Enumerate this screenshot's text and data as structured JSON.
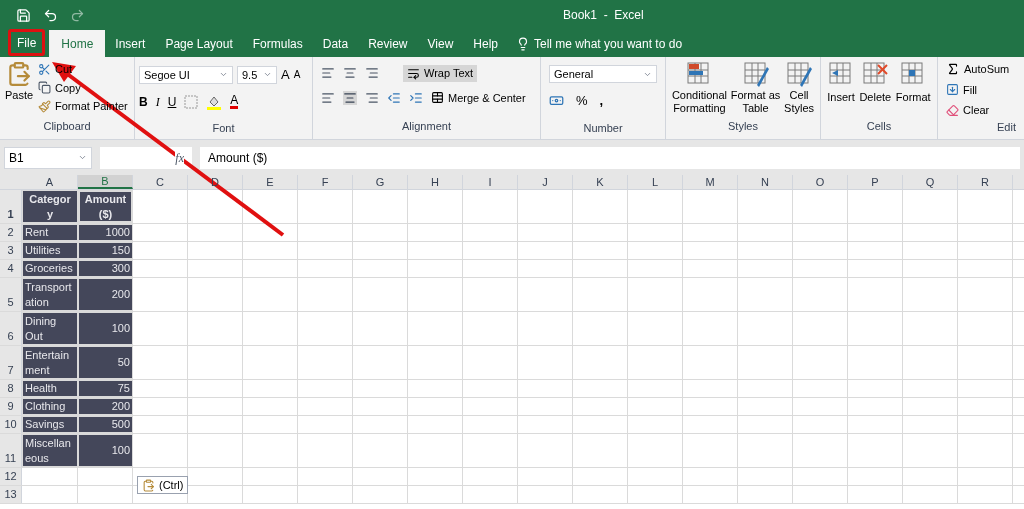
{
  "title_bar": {
    "title": "Book1  -  Excel"
  },
  "tabs": [
    {
      "label": "File",
      "selected": false
    },
    {
      "label": "Home",
      "selected": true
    },
    {
      "label": "Insert",
      "selected": false
    },
    {
      "label": "Page Layout",
      "selected": false
    },
    {
      "label": "Formulas",
      "selected": false
    },
    {
      "label": "Data",
      "selected": false
    },
    {
      "label": "Review",
      "selected": false
    },
    {
      "label": "View",
      "selected": false
    },
    {
      "label": "Help",
      "selected": false
    }
  ],
  "tell_me": {
    "placeholder": "Tell me what you want to do"
  },
  "ribbon": {
    "clipboard": {
      "label": "Clipboard",
      "paste": "Paste",
      "cut": "Cut",
      "copy": "Copy",
      "format_painter": "Format Painter"
    },
    "font": {
      "label": "Font",
      "font_name": "Segoe UI",
      "font_size": "9.5",
      "bold": "B",
      "italic": "I",
      "underline": "U",
      "grow": "A",
      "shrink": "A",
      "font_color": "A"
    },
    "alignment": {
      "label": "Alignment",
      "wrap_text": "Wrap Text",
      "merge": "Merge & Center"
    },
    "number": {
      "label": "Number",
      "format": "General",
      "percent": "%",
      "comma": ","
    },
    "styles": {
      "label": "Styles",
      "buttons": [
        [
          "Conditional",
          "Formatting"
        ],
        [
          "Format as",
          "Table"
        ],
        [
          "Cell",
          "Styles"
        ]
      ]
    },
    "cells": {
      "label": "Cells",
      "buttons": [
        "Insert",
        "Delete",
        "Format"
      ]
    },
    "editing": {
      "label": "Edit",
      "autosum": "AutoSum",
      "fill": "Fill",
      "clear": "Clear"
    }
  },
  "formula_bar": {
    "name_box": "B1",
    "function_label": "fx",
    "value": "Amount ($)"
  },
  "sheet": {
    "columns": [
      {
        "label": "A",
        "selected": false
      },
      {
        "label": "B",
        "selected": true
      },
      {
        "label": "C",
        "selected": false
      },
      {
        "label": "D",
        "selected": false
      },
      {
        "label": "E",
        "selected": false
      },
      {
        "label": "F",
        "selected": false
      },
      {
        "label": "G",
        "selected": false
      },
      {
        "label": "H",
        "selected": false
      },
      {
        "label": "I",
        "selected": false
      },
      {
        "label": "J",
        "selected": false
      },
      {
        "label": "K",
        "selected": false
      },
      {
        "label": "L",
        "selected": false
      },
      {
        "label": "M",
        "selected": false
      },
      {
        "label": "N",
        "selected": false
      },
      {
        "label": "O",
        "selected": false
      },
      {
        "label": "P",
        "selected": false
      },
      {
        "label": "Q",
        "selected": false
      },
      {
        "label": "R",
        "selected": false
      }
    ],
    "rows": [
      {
        "number": "1",
        "header": true,
        "cells": [
          [
            "Categor",
            "y"
          ],
          [
            "Amount",
            "($)"
          ]
        ]
      },
      {
        "number": "2",
        "cells": [
          [
            "Rent"
          ],
          [
            "1000"
          ]
        ]
      },
      {
        "number": "3",
        "cells": [
          [
            "Utilities"
          ],
          [
            "150"
          ]
        ]
      },
      {
        "number": "4",
        "cells": [
          [
            "Groceries"
          ],
          [
            "300"
          ]
        ]
      },
      {
        "number": "5",
        "cells": [
          [
            "Transport",
            "ation"
          ],
          [
            "200"
          ]
        ]
      },
      {
        "number": "6",
        "cells": [
          [
            "Dining",
            "Out"
          ],
          [
            "100"
          ]
        ]
      },
      {
        "number": "7",
        "cells": [
          [
            "Entertain",
            "ment"
          ],
          [
            "50"
          ]
        ]
      },
      {
        "number": "8",
        "cells": [
          [
            "Health"
          ],
          [
            "75"
          ]
        ]
      },
      {
        "number": "9",
        "cells": [
          [
            "Clothing"
          ],
          [
            "200"
          ]
        ]
      },
      {
        "number": "10",
        "cells": [
          [
            "Savings"
          ],
          [
            "500"
          ]
        ]
      },
      {
        "number": "11",
        "cells": [
          [
            "Miscellan",
            "eous"
          ],
          [
            "100"
          ]
        ]
      },
      {
        "number": "12",
        "cells": []
      },
      {
        "number": "13",
        "cells": []
      }
    ]
  },
  "paste_options": {
    "label": "(Ctrl)"
  }
}
